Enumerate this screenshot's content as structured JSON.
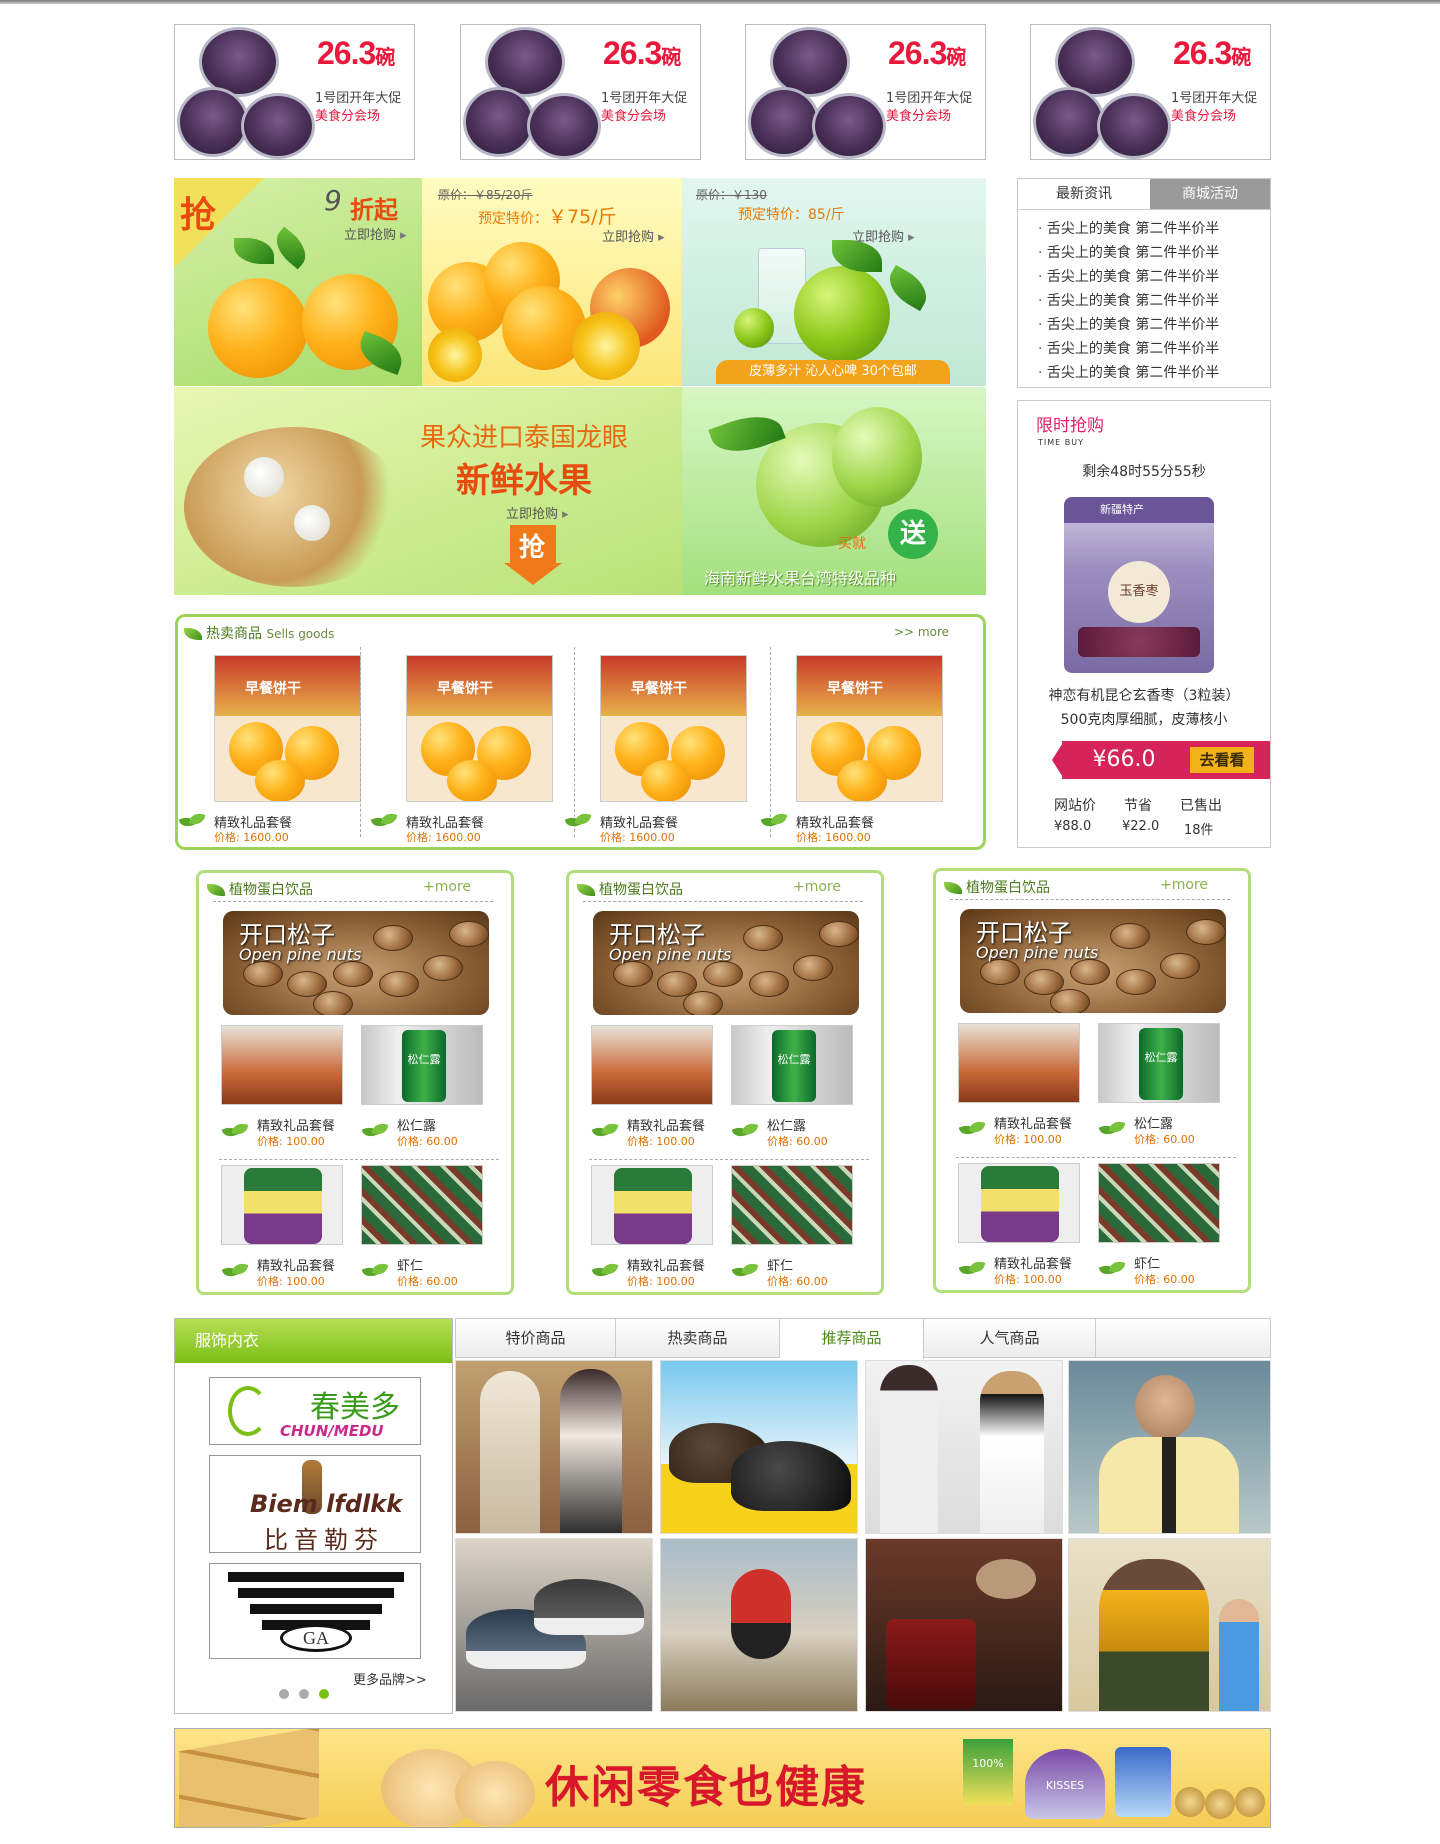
{
  "promos": [
    {
      "price": "26.3",
      "unit": "碗",
      "line1": "1号团开年大促",
      "line2": "美食分会场"
    },
    {
      "price": "26.3",
      "unit": "碗",
      "line1": "1号团开年大促",
      "line2": "美食分会场"
    },
    {
      "price": "26.3",
      "unit": "碗",
      "line1": "1号团开年大促",
      "line2": "美食分会场"
    },
    {
      "price": "26.3",
      "unit": "碗",
      "line1": "1号团开年大促",
      "line2": "美食分会场"
    }
  ],
  "fruit": {
    "tile1": {
      "grab": "抢",
      "discount_num": "9",
      "discount_text": "折起",
      "buy": "立即抢购"
    },
    "tile2": {
      "orig": "原价：￥85/20斤",
      "special_label": "预定特价：",
      "special_price": "￥75/斤",
      "buy": "立即抢购"
    },
    "tile3": {
      "orig": "原价：￥130",
      "special": "预定特价：85/斤",
      "buy": "立即抢购",
      "footer": "皮薄多汁 沁人心啤 30个包邮"
    },
    "tile4": {
      "title": "果众进口泰国龙眼",
      "subtitle": "新鲜水果",
      "buy": "立即抢购",
      "grab": "抢"
    },
    "tile5": {
      "buy_label": "买就",
      "gift": "送",
      "caption": "海南新鲜水果台湾特级品种"
    }
  },
  "news": {
    "tabs": [
      "最新资讯",
      "商城活动"
    ],
    "items": [
      "舌尖上的美食  第二件半价半",
      "舌尖上的美食  第二件半价半",
      "舌尖上的美食  第二件半价半",
      "舌尖上的美食  第二件半价半",
      "舌尖上的美食  第二件半价半",
      "舌尖上的美食  第二件半价半",
      "舌尖上的美食  第二件半价半"
    ]
  },
  "timebuy": {
    "title": "限时抢购",
    "subtitle": "TIME BUY",
    "countdown": "剩余48时55分55秒",
    "bag_label": "新疆特产",
    "bag_brand": "玉香枣",
    "product_line1": "神恋有机昆仑玄香枣（3粒装）",
    "product_line2": "500克肉厚细腻，皮薄核小",
    "price": "¥66.0",
    "go_label": "去看看",
    "stats_labels": [
      "网站价",
      "节省",
      "已售出"
    ],
    "stats_values": [
      "¥88.0",
      "¥22.0",
      "18件"
    ]
  },
  "hot": {
    "title": "热卖商品",
    "title_en": "Sells goods",
    "more": ">> more",
    "biscuit_label": "早餐饼干",
    "items": [
      {
        "name": "精致礼品套餐",
        "price": "价格: 1600.00"
      },
      {
        "name": "精致礼品套餐",
        "price": "价格: 1600.00"
      },
      {
        "name": "精致礼品套餐",
        "price": "价格: 1600.00"
      },
      {
        "name": "精致礼品套餐",
        "price": "价格: 1600.00"
      }
    ]
  },
  "plant": {
    "title": "植物蛋白饮品",
    "more": "+more",
    "banner_cn": "开口松子",
    "banner_en": "Open pine nuts",
    "drink_label": "松仁露",
    "boxes": [
      {
        "items": [
          {
            "name": "精致礼品套餐",
            "price": "价格: 100.00"
          },
          {
            "name": "松仁露",
            "price": "价格: 60.00"
          },
          {
            "name": "精致礼品套餐",
            "price": "价格: 100.00"
          },
          {
            "name": "虾仁",
            "price": "价格: 60.00"
          }
        ]
      },
      {
        "items": [
          {
            "name": "精致礼品套餐",
            "price": "价格: 100.00"
          },
          {
            "name": "松仁露",
            "price": "价格: 60.00"
          },
          {
            "name": "精致礼品套餐",
            "price": "价格: 100.00"
          },
          {
            "name": "虾仁",
            "price": "价格: 60.00"
          }
        ]
      },
      {
        "items": [
          {
            "name": "精致礼品套餐",
            "price": "价格: 100.00"
          },
          {
            "name": "松仁露",
            "price": "价格: 60.00"
          },
          {
            "name": "精致礼品套餐",
            "price": "价格: 100.00"
          },
          {
            "name": "虾仁",
            "price": "价格: 60.00"
          }
        ]
      }
    ]
  },
  "clothing": {
    "title": "服饰内衣",
    "brands": [
      {
        "cn": "春美多",
        "en": "CHUN/MEDU"
      },
      {
        "en": "Biem lfdlkk",
        "cn": "比音勒芬"
      },
      {
        "en": "GA"
      }
    ],
    "more_brands": "更多品牌>>",
    "tabs": [
      "特价商品",
      "热卖商品",
      "推荐商品",
      "人气商品"
    ],
    "active_tab": 2
  },
  "snack_banner": {
    "text": "休闲零食也健康",
    "product1": "100%",
    "product2": "KISSES"
  },
  "colors": {
    "accent_green": "#7cbf14",
    "price_orange": "#e07000",
    "promo_red": "#e8193c",
    "magenta": "#e0206a"
  }
}
